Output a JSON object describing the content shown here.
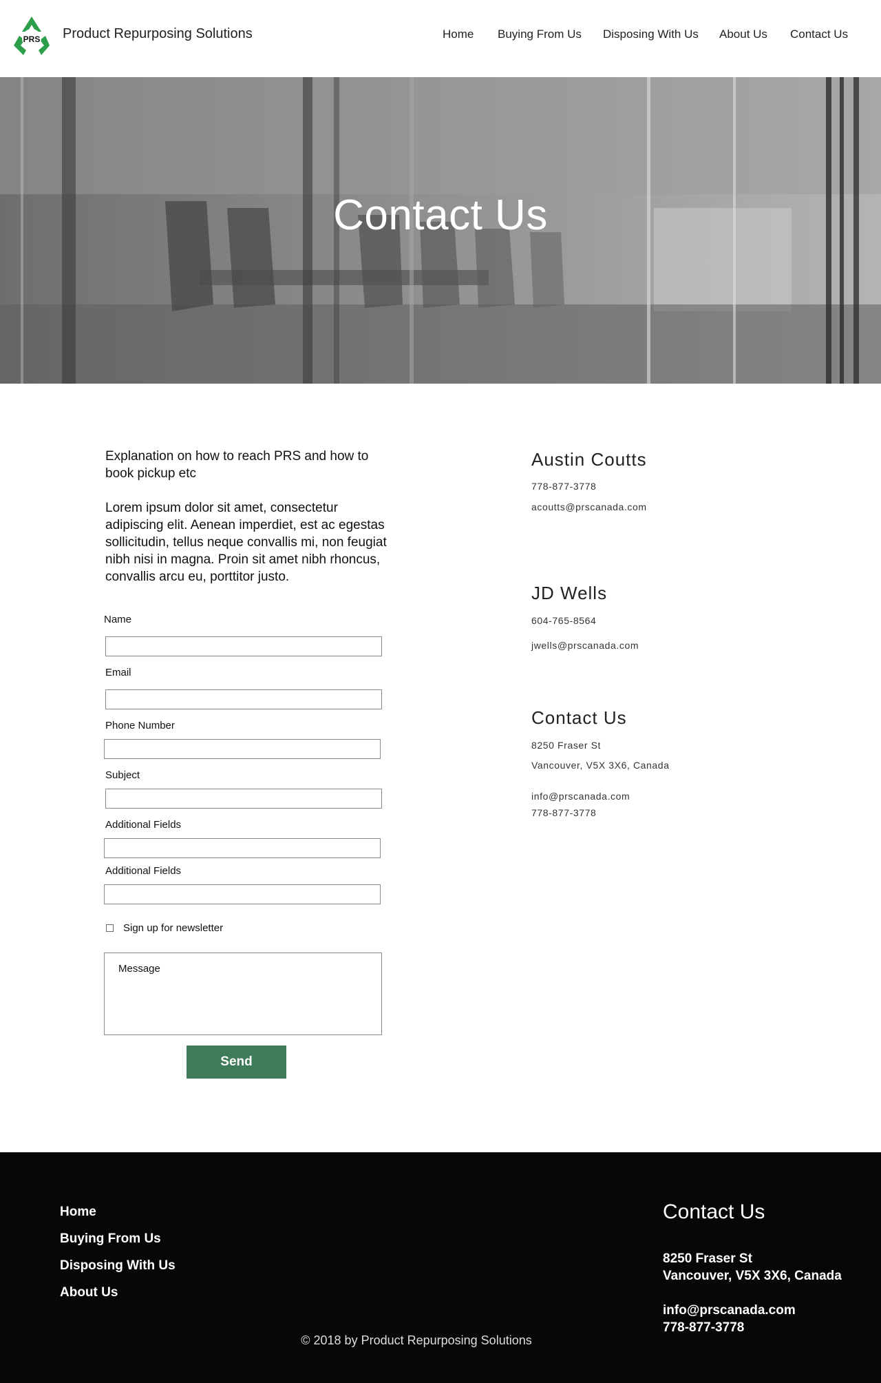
{
  "header": {
    "brand": "Product Repurposing Solutions",
    "logo_text": "PRS",
    "nav": [
      "Home",
      "Buying From Us",
      "Disposing With Us",
      "About Us",
      "Contact Us"
    ]
  },
  "hero": {
    "title": "Contact Us"
  },
  "intro": {
    "heading": "Explanation on how to reach PRS and how to book pickup etc",
    "body": "Lorem ipsum dolor sit amet, consectetur adipiscing elit. Aenean imperdiet, est ac egestas sollicitudin, tellus neque convallis mi, non feugiat  nibh nisi in magna. Proin sit amet nibh rhoncus, convallis arcu eu, porttitor justo."
  },
  "form": {
    "name_label": "Name",
    "email_label": "Email",
    "phone_label": "Phone Number",
    "subject_label": "Subject",
    "additional1_label": "Additional Fields",
    "additional2_label": "Additional Fields",
    "newsletter_label": "Sign up for newsletter",
    "message_placeholder": "Message",
    "send_label": "Send"
  },
  "contacts": {
    "person1": {
      "name": "Austin Coutts",
      "phone": "778-877-3778",
      "email": "acoutts@prscanada.com"
    },
    "person2": {
      "name": "JD Wells",
      "phone": "604-765-8564",
      "email": "jwells@prscanada.com"
    },
    "office": {
      "title": "Contact Us",
      "street": "8250 Fraser St",
      "city": "Vancouver, V5X 3X6, Canada",
      "email": "info@prscanada.com",
      "phone": "778-877-3778"
    }
  },
  "footer": {
    "links": [
      "Home",
      "Buying From Us",
      "Disposing With Us",
      "About Us"
    ],
    "title": "Contact Us",
    "street": "8250 Fraser St",
    "city": "Vancouver, V5X 3X6, Canada",
    "email": "info@prscanada.com",
    "phone": "778-877-3778",
    "copyright": "© 2018  by Product Repurposing Solutions"
  },
  "colors": {
    "accent": "#3e7b58",
    "logo_green": "#2e9e4a",
    "footer_bg": "#070707"
  },
  "icons": {
    "logo": "recycle-icon",
    "checkbox": "checkbox-icon"
  }
}
